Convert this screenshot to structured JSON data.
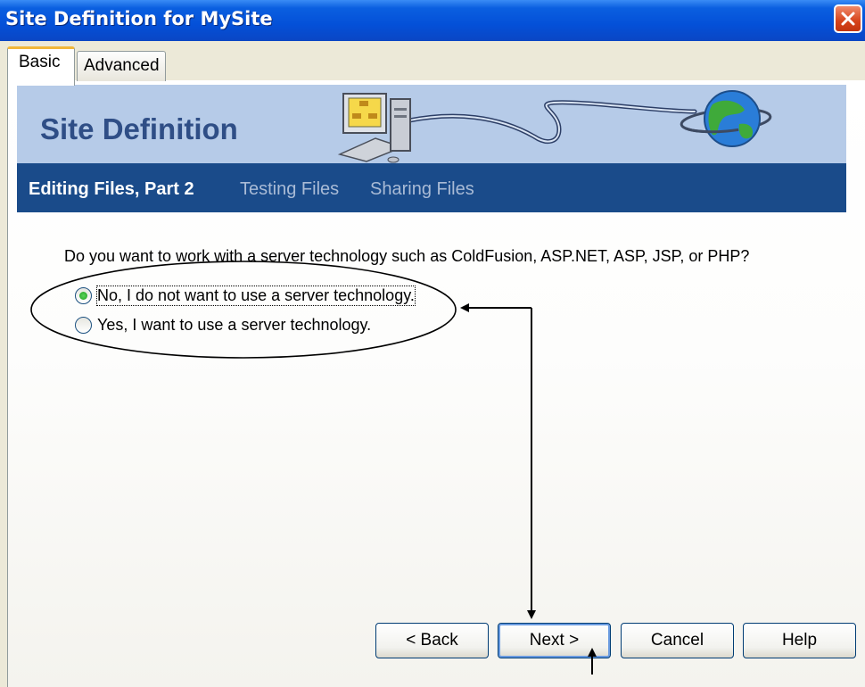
{
  "window": {
    "title": "Site Definition for MySite"
  },
  "tabs": [
    {
      "label": "Basic",
      "active": true
    },
    {
      "label": "Advanced",
      "active": false
    }
  ],
  "banner": {
    "title": "Site Definition"
  },
  "steps": [
    {
      "label": "Editing Files, Part 2",
      "current": true
    },
    {
      "label": "Testing Files",
      "current": false
    },
    {
      "label": "Sharing Files",
      "current": false
    }
  ],
  "question": "Do you want to work with a server technology such as ColdFusion, ASP.NET, ASP, JSP, or PHP?",
  "options": [
    {
      "label": "No, I do not want to use a server technology.",
      "selected": true
    },
    {
      "label": "Yes, I want to use a server technology.",
      "selected": false
    }
  ],
  "buttons": {
    "back": "< Back",
    "next": "Next >",
    "cancel": "Cancel",
    "help": "Help"
  },
  "colors": {
    "title_bar": "#0450d8",
    "banner": "#b6cbe8",
    "step_bar": "#1a4b8a",
    "banner_title": "#2f4e86"
  },
  "icons": [
    "close-icon",
    "computer-icon",
    "globe-icon",
    "cable-icon"
  ]
}
